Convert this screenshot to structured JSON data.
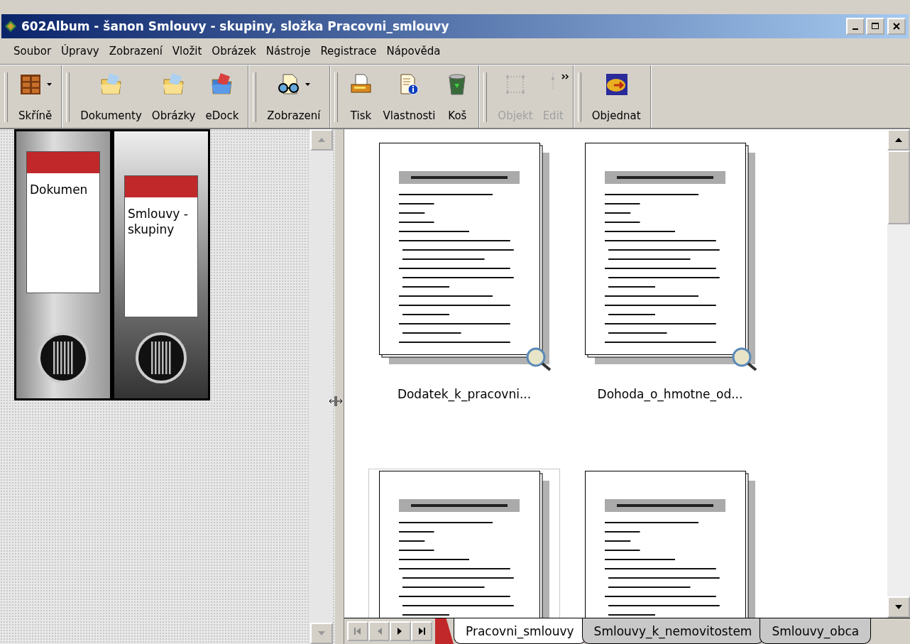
{
  "window": {
    "title": "602Album - šanon Smlouvy - skupiny, složka Pracovni_smlouvy"
  },
  "menu": [
    "Soubor",
    "Úpravy",
    "Zobrazení",
    "Vložit",
    "Obrázek",
    "Nástroje",
    "Registrace",
    "Nápověda"
  ],
  "toolbar_groups": [
    {
      "buttons": [
        {
          "label": "Skříně",
          "disabled": false,
          "dropdown": true
        }
      ]
    },
    {
      "buttons": [
        {
          "label": "Dokumenty",
          "disabled": false,
          "dropdown": false
        },
        {
          "label": "Obrázky",
          "disabled": false,
          "dropdown": false
        },
        {
          "label": "eDock",
          "disabled": false,
          "dropdown": false
        }
      ]
    },
    {
      "buttons": [
        {
          "label": "Zobrazení",
          "disabled": false,
          "dropdown": true
        }
      ]
    },
    {
      "buttons": [
        {
          "label": "Tisk",
          "disabled": false,
          "dropdown": false
        },
        {
          "label": "Vlastnosti",
          "disabled": false,
          "dropdown": false
        },
        {
          "label": "Koš",
          "disabled": false,
          "dropdown": false
        }
      ]
    },
    {
      "buttons": [
        {
          "label": "Objekt",
          "disabled": true,
          "dropdown": false
        },
        {
          "label": "Edit",
          "disabled": true,
          "dropdown": false
        }
      ]
    },
    {
      "buttons": [
        {
          "label": "Objednat",
          "disabled": false,
          "dropdown": false
        }
      ]
    }
  ],
  "binders": [
    {
      "label": "Dokumen"
    },
    {
      "label": "Smlouvy - skupiny"
    }
  ],
  "documents": [
    {
      "label": "Dodatek_k_pracovni...",
      "selected": false
    },
    {
      "label": "Dohoda_o_hmotne_od...",
      "selected": false
    },
    {
      "selected": true
    },
    {
      "selected": false
    }
  ],
  "folder_tabs": [
    {
      "label": "Pracovni_smlouvy",
      "selected": true
    },
    {
      "label": "Smlouvy_k_nemovitostem",
      "selected": false
    },
    {
      "label": "Smlouvy_obca",
      "selected": false
    }
  ]
}
